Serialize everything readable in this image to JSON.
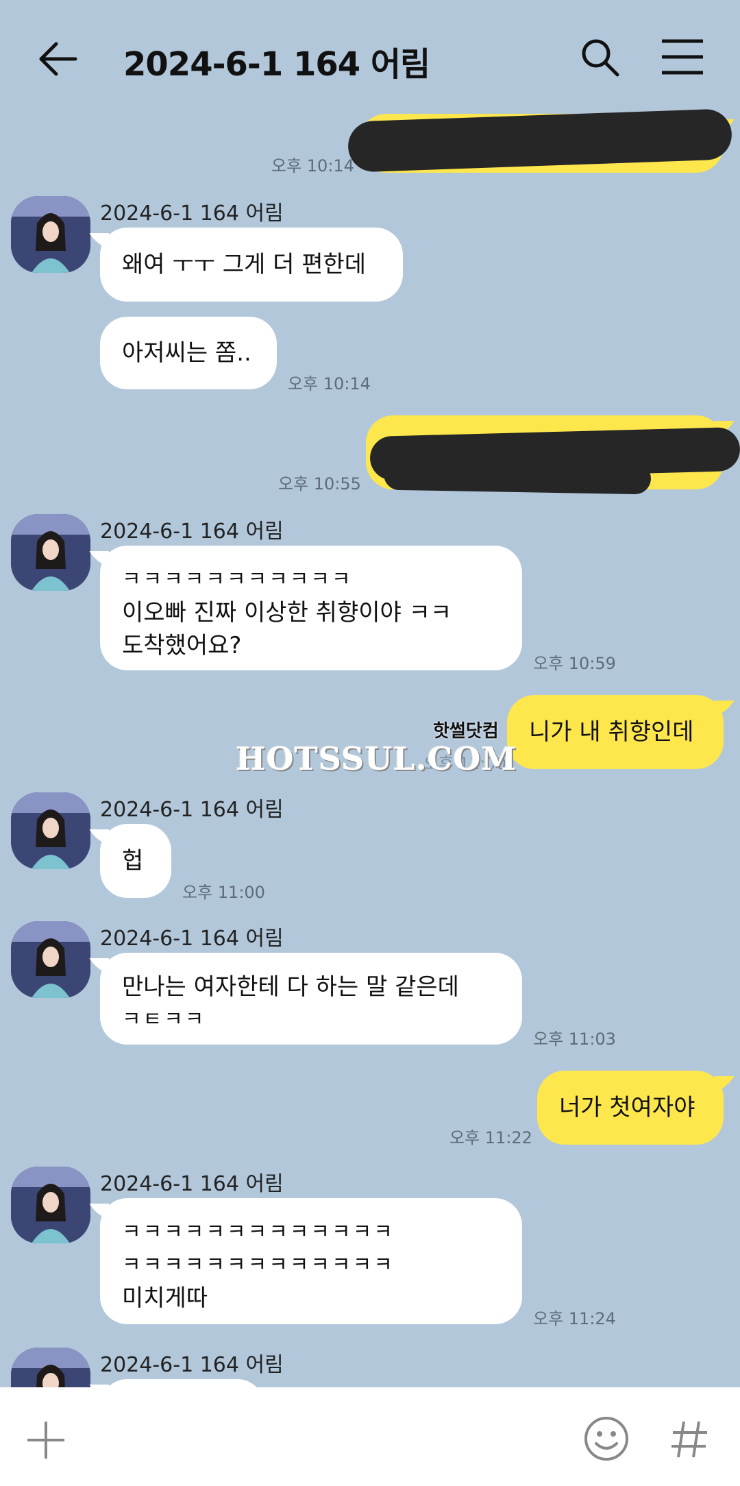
{
  "header": {
    "title": "2024-6-1 164 어림"
  },
  "icons": {
    "back": "arrow-left-icon",
    "search": "search-icon",
    "menu": "hamburger-menu-icon",
    "plus": "plus-icon",
    "emoji": "smiley-icon",
    "hash": "hashtag-icon"
  },
  "colors": {
    "background": "#b2c7da",
    "my_bubble": "#fee64d",
    "their_bubble": "#ffffff"
  },
  "messages": [
    {
      "from": "me",
      "text": "",
      "redacted": true,
      "time": "오후 10:14"
    },
    {
      "from": "them",
      "sender": "2024-6-1 164 어림",
      "text": "왜여 ㅜㅜ 그게 더 편한데"
    },
    {
      "from": "them",
      "text": "아저씨는 쫌..",
      "time": "오후 10:14"
    },
    {
      "from": "me",
      "text": "",
      "redacted": true,
      "time": "오후 10:55"
    },
    {
      "from": "them",
      "sender": "2024-6-1 164 어림",
      "lines": [
        "ㅋㅋㅋㅋㅋㅋㅋㅋㅋㅋㅋ",
        "이오빠 진짜 이상한 취향이야 ㅋㅋ",
        "도착했어요?"
      ],
      "time": "오후 10:59"
    },
    {
      "from": "me",
      "text": "니가 내 취향인데",
      "time": "오후 11:00"
    },
    {
      "from": "them",
      "sender": "2024-6-1 164 어림",
      "text": "헙",
      "time": "오후 11:00"
    },
    {
      "from": "them",
      "sender": "2024-6-1 164 어림",
      "lines": [
        "만나는 여자한테 다 하는 말 같은데",
        "ㅋㅌㅋㅋ"
      ],
      "time": "오후 11:03"
    },
    {
      "from": "me",
      "text": "너가 첫여자야",
      "time": "오후 11:22"
    },
    {
      "from": "them",
      "sender": "2024-6-1 164 어림",
      "lines": [
        "ㅋㅋㅋㅋㅋㅋㅋㅋㅋㅋㅋㅋㅋ",
        "ㅋㅋㅋㅋㅋㅋㅋㅋㅋㅋㅋㅋㅋ",
        "미치게따"
      ],
      "time": "오후 11:24"
    },
    {
      "from": "them",
      "sender": "2024-6-1 164 어림",
      "text": ""
    }
  ],
  "watermark": {
    "main": "HOTSSUL.COM",
    "small": "핫썰닷컴"
  }
}
